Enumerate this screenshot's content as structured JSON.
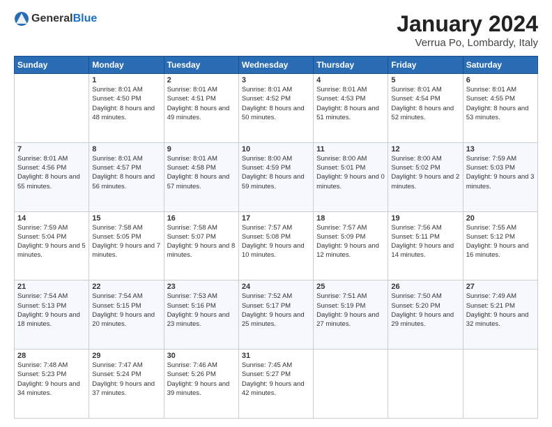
{
  "header": {
    "logo_general": "General",
    "logo_blue": "Blue",
    "title": "January 2024",
    "subtitle": "Verrua Po, Lombardy, Italy"
  },
  "weekdays": [
    "Sunday",
    "Monday",
    "Tuesday",
    "Wednesday",
    "Thursday",
    "Friday",
    "Saturday"
  ],
  "weeks": [
    [
      {
        "day": "",
        "sunrise": "",
        "sunset": "",
        "daylight": ""
      },
      {
        "day": "1",
        "sunrise": "Sunrise: 8:01 AM",
        "sunset": "Sunset: 4:50 PM",
        "daylight": "Daylight: 8 hours and 48 minutes."
      },
      {
        "day": "2",
        "sunrise": "Sunrise: 8:01 AM",
        "sunset": "Sunset: 4:51 PM",
        "daylight": "Daylight: 8 hours and 49 minutes."
      },
      {
        "day": "3",
        "sunrise": "Sunrise: 8:01 AM",
        "sunset": "Sunset: 4:52 PM",
        "daylight": "Daylight: 8 hours and 50 minutes."
      },
      {
        "day": "4",
        "sunrise": "Sunrise: 8:01 AM",
        "sunset": "Sunset: 4:53 PM",
        "daylight": "Daylight: 8 hours and 51 minutes."
      },
      {
        "day": "5",
        "sunrise": "Sunrise: 8:01 AM",
        "sunset": "Sunset: 4:54 PM",
        "daylight": "Daylight: 8 hours and 52 minutes."
      },
      {
        "day": "6",
        "sunrise": "Sunrise: 8:01 AM",
        "sunset": "Sunset: 4:55 PM",
        "daylight": "Daylight: 8 hours and 53 minutes."
      }
    ],
    [
      {
        "day": "7",
        "sunrise": "Sunrise: 8:01 AM",
        "sunset": "Sunset: 4:56 PM",
        "daylight": "Daylight: 8 hours and 55 minutes."
      },
      {
        "day": "8",
        "sunrise": "Sunrise: 8:01 AM",
        "sunset": "Sunset: 4:57 PM",
        "daylight": "Daylight: 8 hours and 56 minutes."
      },
      {
        "day": "9",
        "sunrise": "Sunrise: 8:01 AM",
        "sunset": "Sunset: 4:58 PM",
        "daylight": "Daylight: 8 hours and 57 minutes."
      },
      {
        "day": "10",
        "sunrise": "Sunrise: 8:00 AM",
        "sunset": "Sunset: 4:59 PM",
        "daylight": "Daylight: 8 hours and 59 minutes."
      },
      {
        "day": "11",
        "sunrise": "Sunrise: 8:00 AM",
        "sunset": "Sunset: 5:01 PM",
        "daylight": "Daylight: 9 hours and 0 minutes."
      },
      {
        "day": "12",
        "sunrise": "Sunrise: 8:00 AM",
        "sunset": "Sunset: 5:02 PM",
        "daylight": "Daylight: 9 hours and 2 minutes."
      },
      {
        "day": "13",
        "sunrise": "Sunrise: 7:59 AM",
        "sunset": "Sunset: 5:03 PM",
        "daylight": "Daylight: 9 hours and 3 minutes."
      }
    ],
    [
      {
        "day": "14",
        "sunrise": "Sunrise: 7:59 AM",
        "sunset": "Sunset: 5:04 PM",
        "daylight": "Daylight: 9 hours and 5 minutes."
      },
      {
        "day": "15",
        "sunrise": "Sunrise: 7:58 AM",
        "sunset": "Sunset: 5:05 PM",
        "daylight": "Daylight: 9 hours and 7 minutes."
      },
      {
        "day": "16",
        "sunrise": "Sunrise: 7:58 AM",
        "sunset": "Sunset: 5:07 PM",
        "daylight": "Daylight: 9 hours and 8 minutes."
      },
      {
        "day": "17",
        "sunrise": "Sunrise: 7:57 AM",
        "sunset": "Sunset: 5:08 PM",
        "daylight": "Daylight: 9 hours and 10 minutes."
      },
      {
        "day": "18",
        "sunrise": "Sunrise: 7:57 AM",
        "sunset": "Sunset: 5:09 PM",
        "daylight": "Daylight: 9 hours and 12 minutes."
      },
      {
        "day": "19",
        "sunrise": "Sunrise: 7:56 AM",
        "sunset": "Sunset: 5:11 PM",
        "daylight": "Daylight: 9 hours and 14 minutes."
      },
      {
        "day": "20",
        "sunrise": "Sunrise: 7:55 AM",
        "sunset": "Sunset: 5:12 PM",
        "daylight": "Daylight: 9 hours and 16 minutes."
      }
    ],
    [
      {
        "day": "21",
        "sunrise": "Sunrise: 7:54 AM",
        "sunset": "Sunset: 5:13 PM",
        "daylight": "Daylight: 9 hours and 18 minutes."
      },
      {
        "day": "22",
        "sunrise": "Sunrise: 7:54 AM",
        "sunset": "Sunset: 5:15 PM",
        "daylight": "Daylight: 9 hours and 20 minutes."
      },
      {
        "day": "23",
        "sunrise": "Sunrise: 7:53 AM",
        "sunset": "Sunset: 5:16 PM",
        "daylight": "Daylight: 9 hours and 23 minutes."
      },
      {
        "day": "24",
        "sunrise": "Sunrise: 7:52 AM",
        "sunset": "Sunset: 5:17 PM",
        "daylight": "Daylight: 9 hours and 25 minutes."
      },
      {
        "day": "25",
        "sunrise": "Sunrise: 7:51 AM",
        "sunset": "Sunset: 5:19 PM",
        "daylight": "Daylight: 9 hours and 27 minutes."
      },
      {
        "day": "26",
        "sunrise": "Sunrise: 7:50 AM",
        "sunset": "Sunset: 5:20 PM",
        "daylight": "Daylight: 9 hours and 29 minutes."
      },
      {
        "day": "27",
        "sunrise": "Sunrise: 7:49 AM",
        "sunset": "Sunset: 5:21 PM",
        "daylight": "Daylight: 9 hours and 32 minutes."
      }
    ],
    [
      {
        "day": "28",
        "sunrise": "Sunrise: 7:48 AM",
        "sunset": "Sunset: 5:23 PM",
        "daylight": "Daylight: 9 hours and 34 minutes."
      },
      {
        "day": "29",
        "sunrise": "Sunrise: 7:47 AM",
        "sunset": "Sunset: 5:24 PM",
        "daylight": "Daylight: 9 hours and 37 minutes."
      },
      {
        "day": "30",
        "sunrise": "Sunrise: 7:46 AM",
        "sunset": "Sunset: 5:26 PM",
        "daylight": "Daylight: 9 hours and 39 minutes."
      },
      {
        "day": "31",
        "sunrise": "Sunrise: 7:45 AM",
        "sunset": "Sunset: 5:27 PM",
        "daylight": "Daylight: 9 hours and 42 minutes."
      },
      {
        "day": "",
        "sunrise": "",
        "sunset": "",
        "daylight": ""
      },
      {
        "day": "",
        "sunrise": "",
        "sunset": "",
        "daylight": ""
      },
      {
        "day": "",
        "sunrise": "",
        "sunset": "",
        "daylight": ""
      }
    ]
  ]
}
